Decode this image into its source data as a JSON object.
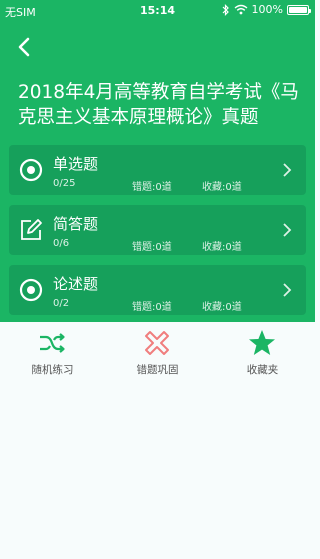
{
  "status": {
    "carrier": "无SIM",
    "time": "15:14",
    "battery": "100%"
  },
  "header": {
    "title": "2018年4月高等教育自学考试《马克思主义基本原理概论》真题"
  },
  "sections": [
    {
      "name": "单选题",
      "progress": "0/25",
      "wrong": "错题:0道",
      "fav": "收藏:0道",
      "icon": "target-icon"
    },
    {
      "name": "简答题",
      "progress": "0/6",
      "wrong": "错题:0道",
      "fav": "收藏:0道",
      "icon": "edit-icon"
    },
    {
      "name": "论述题",
      "progress": "0/2",
      "wrong": "错题:0道",
      "fav": "收藏:0道",
      "icon": "target-icon"
    }
  ],
  "tabs": [
    {
      "label": "随机练习",
      "icon": "shuffle-icon",
      "color": "#1bb564"
    },
    {
      "label": "错题巩固",
      "icon": "cross-icon",
      "color": "#f07e7e"
    },
    {
      "label": "收藏夹",
      "icon": "star-icon",
      "color": "#1bb564"
    }
  ],
  "colors": {
    "primary": "#1bb564",
    "card": "#16a05b",
    "error": "#f07e7e"
  }
}
